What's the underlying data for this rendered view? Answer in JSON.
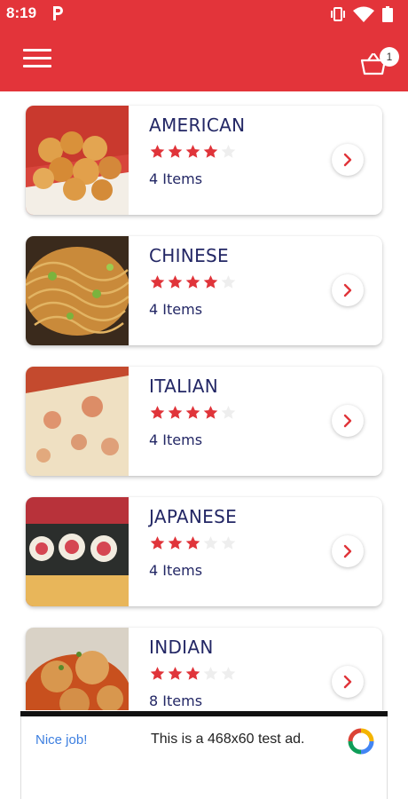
{
  "status_bar": {
    "time": "8:19",
    "icons": [
      "p-app-icon",
      "vibrate-icon",
      "wifi-icon",
      "battery-icon"
    ]
  },
  "app_bar": {
    "menu_icon": "hamburger-menu-icon",
    "cart_icon": "shopping-basket-icon",
    "cart_count": "1",
    "background_color": "#e3343a"
  },
  "categories": [
    {
      "name": "AMERICAN",
      "rating": 4,
      "max_rating": 5,
      "items": "4 Items",
      "image": "fried-food-basket"
    },
    {
      "name": "CHINESE",
      "rating": 4,
      "max_rating": 5,
      "items": "4 Items",
      "image": "noodles"
    },
    {
      "name": "ITALIAN",
      "rating": 4,
      "max_rating": 5,
      "items": "4 Items",
      "image": "pizza"
    },
    {
      "name": "JAPANESE",
      "rating": 3,
      "max_rating": 5,
      "items": "4 Items",
      "image": "sushi-rolls"
    },
    {
      "name": "INDIAN",
      "rating": 3,
      "max_rating": 5,
      "items": "8 Items",
      "image": "curry-meatballs"
    }
  ],
  "ad_banner": {
    "label": "Nice job!",
    "text": "This is a 468x60 test ad.",
    "logo": "ad-logo-icon"
  },
  "colors": {
    "accent": "#e3343a",
    "star_filled": "#e0343a",
    "star_empty": "#eeeeee",
    "title_text": "#232765",
    "ad_label": "#3d7fe0"
  }
}
